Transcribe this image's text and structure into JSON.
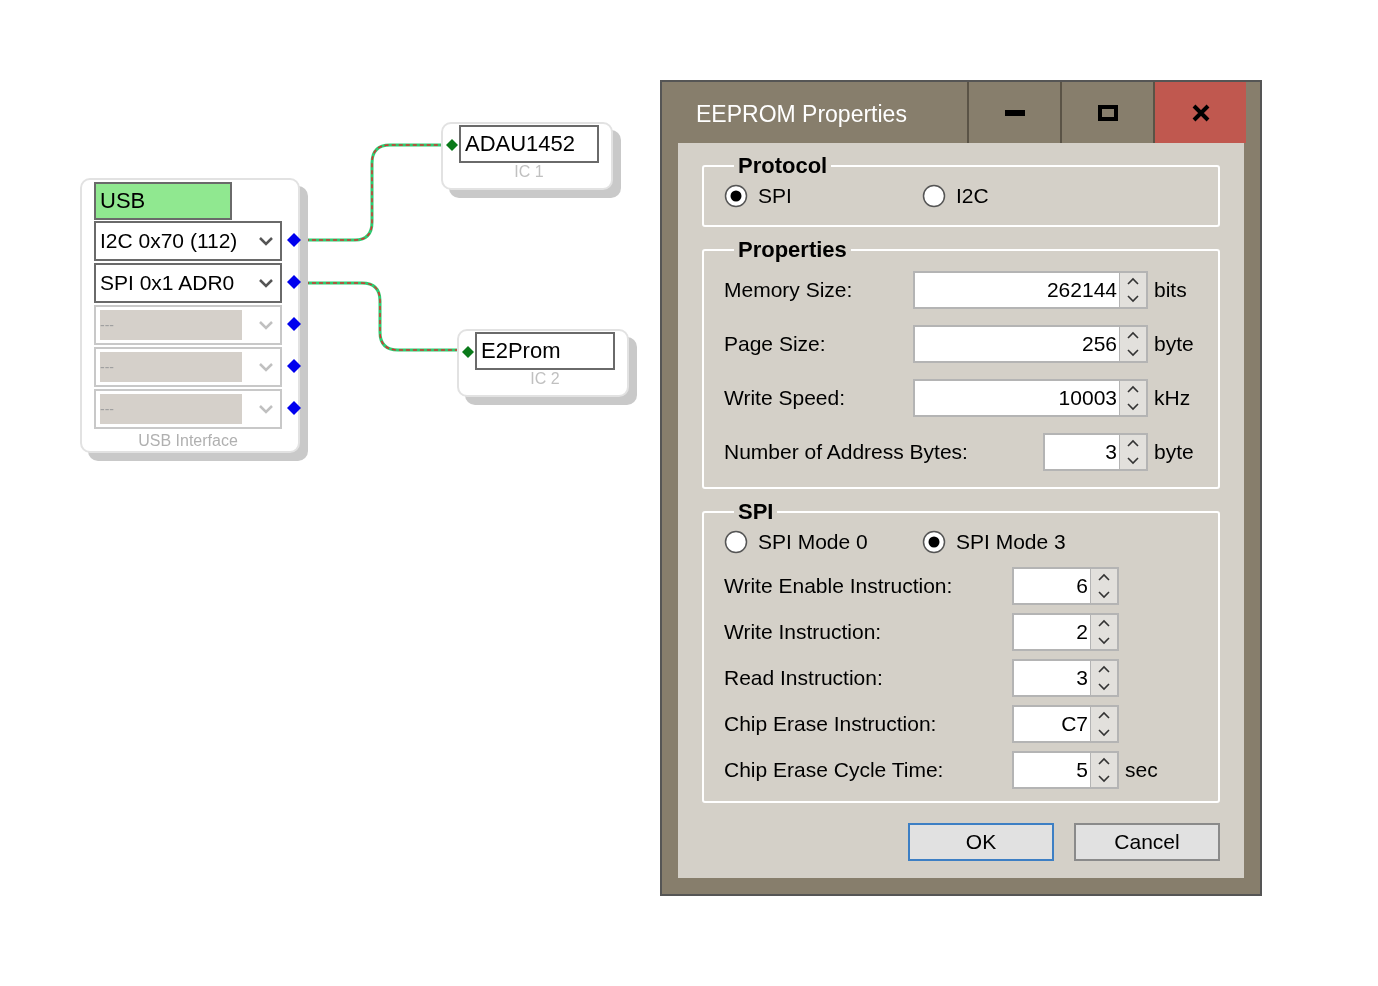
{
  "diagram": {
    "usb_block": {
      "title": "USB",
      "label": "USB Interface",
      "ports": [
        {
          "value": "I2C 0x70 (112)",
          "disabled": false
        },
        {
          "value": "SPI 0x1 ADR0",
          "disabled": false
        },
        {
          "value": "---",
          "disabled": true
        },
        {
          "value": "---",
          "disabled": true
        },
        {
          "value": "---",
          "disabled": true
        }
      ]
    },
    "ics": [
      {
        "name": "ADAU1452",
        "label": "IC 1"
      },
      {
        "name": "E2Prom",
        "label": "IC 2"
      }
    ]
  },
  "dialog": {
    "title": "EEPROM Properties",
    "protocol": {
      "label": "Protocol",
      "options": [
        {
          "label": "SPI",
          "selected": true
        },
        {
          "label": "I2C",
          "selected": false
        }
      ]
    },
    "properties": {
      "label": "Properties",
      "fields": [
        {
          "label": "Memory Size:",
          "value": "262144",
          "unit": "bits",
          "kind": "wide"
        },
        {
          "label": "Page Size:",
          "value": "256",
          "unit": "byte",
          "kind": "wide"
        },
        {
          "label": "Write Speed:",
          "value": "10003",
          "unit": "kHz",
          "kind": "wide"
        },
        {
          "label": "Number of Address Bytes:",
          "value": "3",
          "unit": "byte",
          "kind": "narrow"
        }
      ]
    },
    "spi": {
      "label": "SPI",
      "modes": [
        {
          "label": "SPI Mode 0",
          "selected": false
        },
        {
          "label": "SPI Mode 3",
          "selected": true
        }
      ],
      "fields": [
        {
          "label": "Write Enable Instruction:",
          "value": "6"
        },
        {
          "label": "Write Instruction:",
          "value": "2"
        },
        {
          "label": "Read Instruction:",
          "value": "3"
        },
        {
          "label": "Chip Erase Instruction:",
          "value": "C7"
        },
        {
          "label": "Chip Erase Cycle Time:",
          "value": "5",
          "unit": "sec"
        }
      ]
    },
    "buttons": [
      {
        "label": "OK",
        "default": true
      },
      {
        "label": "Cancel",
        "default": false
      }
    ]
  }
}
